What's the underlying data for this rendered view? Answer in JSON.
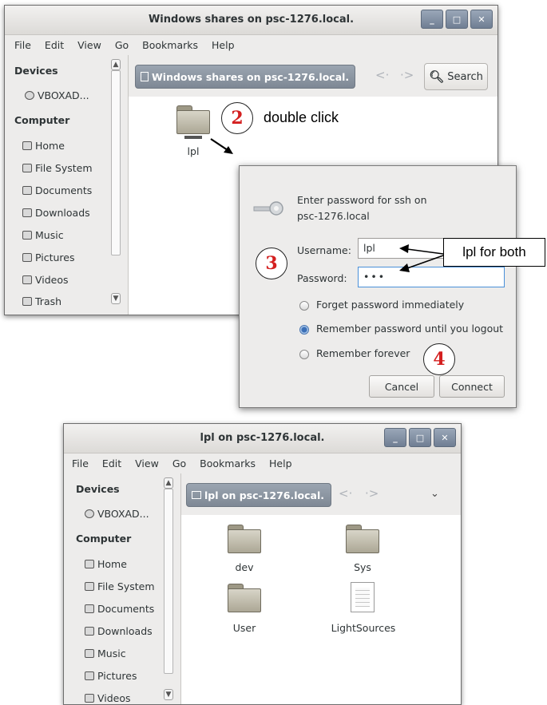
{
  "window1": {
    "title": "Windows shares on psc-1276.local.",
    "menu": [
      "File",
      "Edit",
      "View",
      "Go",
      "Bookmarks",
      "Help"
    ],
    "sidebar": {
      "devices_heading": "Devices",
      "devices": [
        {
          "label": "VBOXAD...",
          "icon": "disc-icon"
        }
      ],
      "computer_heading": "Computer",
      "items": [
        {
          "label": "Home",
          "icon": "home-folder-icon"
        },
        {
          "label": "File System",
          "icon": "drive-icon"
        },
        {
          "label": "Documents",
          "icon": "documents-folder-icon"
        },
        {
          "label": "Downloads",
          "icon": "downloads-folder-icon"
        },
        {
          "label": "Music",
          "icon": "music-folder-icon"
        },
        {
          "label": "Pictures",
          "icon": "pictures-folder-icon"
        },
        {
          "label": "Videos",
          "icon": "videos-folder-icon"
        },
        {
          "label": "Trash",
          "icon": "trash-icon"
        }
      ]
    },
    "path_button": "Windows shares on psc-1276.local.",
    "search_label": "Search",
    "folder_label": "lpl"
  },
  "dialog": {
    "prompt_line1": "Enter password for ssh on",
    "prompt_line2": "psc-1276.local",
    "username_label": "Username:",
    "username_value": "lpl",
    "password_label": "Password:",
    "password_value": "•••",
    "options": [
      {
        "label": "Forget password immediately",
        "selected": false
      },
      {
        "label": "Remember password until you logout",
        "selected": true
      },
      {
        "label": "Remember forever",
        "selected": false
      }
    ],
    "cancel_label": "Cancel",
    "connect_label": "Connect"
  },
  "window2": {
    "title": "lpl on psc-1276.local.",
    "menu": [
      "File",
      "Edit",
      "View",
      "Go",
      "Bookmarks",
      "Help"
    ],
    "sidebar": {
      "devices_heading": "Devices",
      "devices": [
        {
          "label": "VBOXAD...",
          "icon": "disc-icon"
        }
      ],
      "computer_heading": "Computer",
      "items": [
        {
          "label": "Home",
          "icon": "home-folder-icon"
        },
        {
          "label": "File System",
          "icon": "drive-icon"
        },
        {
          "label": "Documents",
          "icon": "documents-folder-icon"
        },
        {
          "label": "Downloads",
          "icon": "downloads-folder-icon"
        },
        {
          "label": "Music",
          "icon": "music-folder-icon"
        },
        {
          "label": "Pictures",
          "icon": "pictures-folder-icon"
        },
        {
          "label": "Videos",
          "icon": "videos-folder-icon"
        }
      ]
    },
    "path_button": "lpl on psc-1276.local.",
    "files": [
      {
        "label": "dev",
        "type": "folder"
      },
      {
        "label": "Sys",
        "type": "folder"
      },
      {
        "label": "User",
        "type": "folder"
      },
      {
        "label": "LightSources",
        "type": "file"
      }
    ]
  },
  "annotations": {
    "step2": "2",
    "step2_note": "double click",
    "step3": "3",
    "step3_note": "lpl for both",
    "step4": "4"
  },
  "colors": {
    "step_number": "#d42020",
    "window_bg": "#edeceb",
    "path_button": "#8a94a0",
    "radio_selected": "#3b6fb6",
    "password_focus": "#4a90d9"
  }
}
